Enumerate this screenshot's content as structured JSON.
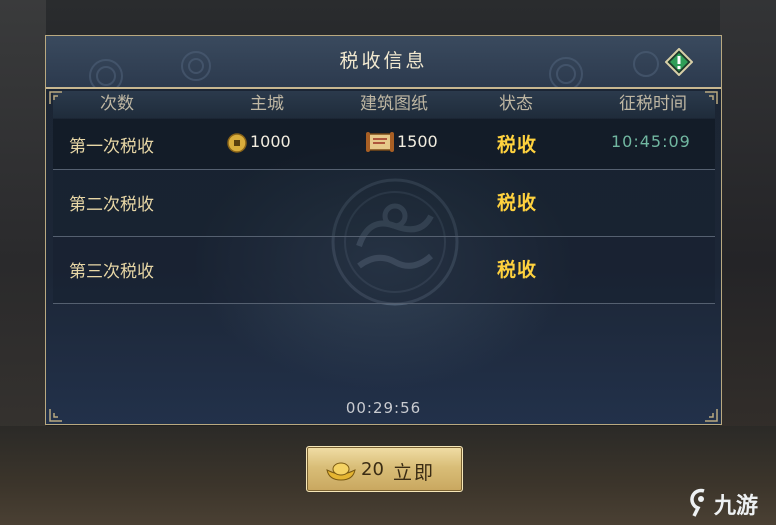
{
  "panel": {
    "title": "税收信息",
    "columns": [
      "次数",
      "主城",
      "建筑图纸",
      "状态",
      "征税时间"
    ],
    "rows": [
      {
        "name": "第一次税收",
        "coin": "1000",
        "blueprint": "1500",
        "status": "税收",
        "time": "10:45:09"
      },
      {
        "name": "第二次税收",
        "status": "税收"
      },
      {
        "name": "第三次税收",
        "status": "税收"
      }
    ],
    "timer": "00:29:56"
  },
  "action_button": {
    "count": "20",
    "label": "立即"
  },
  "watermark": {
    "text": "九游"
  },
  "colors": {
    "gold": "#ffd23e",
    "time_green": "#71b7a1",
    "panel_border": "#b9a980"
  },
  "icons": [
    "info-icon",
    "coin-icon",
    "blueprint-scroll-icon",
    "gold-ingot-icon"
  ]
}
